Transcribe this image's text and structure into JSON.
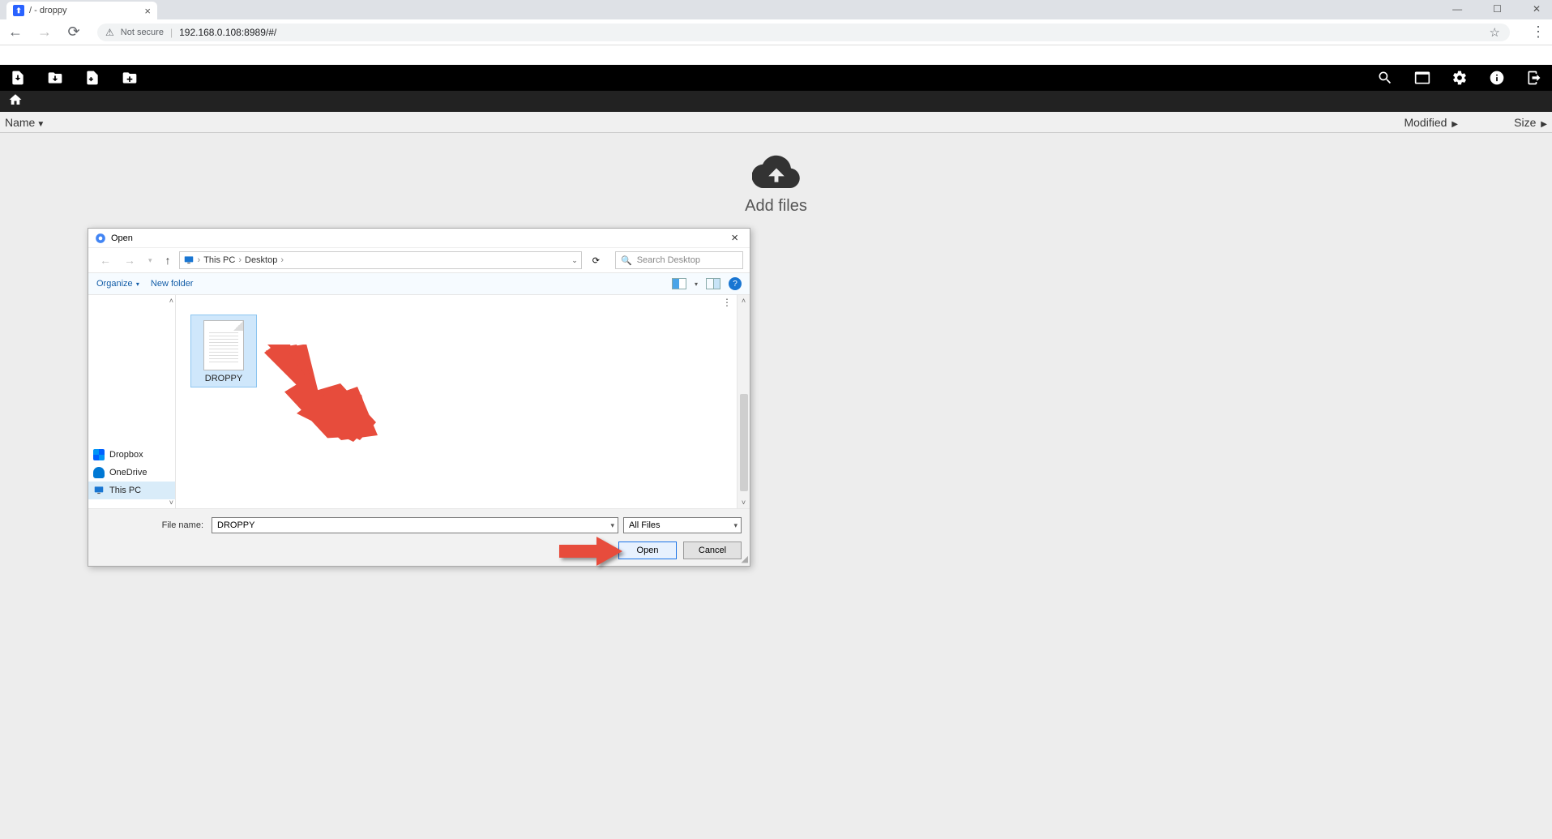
{
  "browser": {
    "tab_title": "/ - droppy",
    "security_label": "Not secure",
    "url": "192.168.0.108:8989/#/"
  },
  "columns": {
    "name": "Name",
    "modified": "Modified",
    "size": "Size"
  },
  "main": {
    "add_files_label": "Add files"
  },
  "dialog": {
    "title": "Open",
    "path": {
      "thispc": "This PC",
      "desktop": "Desktop"
    },
    "search_placeholder": "Search Desktop",
    "organize": "Organize",
    "new_folder": "New folder",
    "sidebar": {
      "dropbox": "Dropbox",
      "onedrive": "OneDrive",
      "thispc": "This PC"
    },
    "file_item": "DROPPY",
    "fn_label": "File name:",
    "fn_value": "DROPPY",
    "type_value": "All Files",
    "open_btn": "Open",
    "cancel_btn": "Cancel"
  }
}
